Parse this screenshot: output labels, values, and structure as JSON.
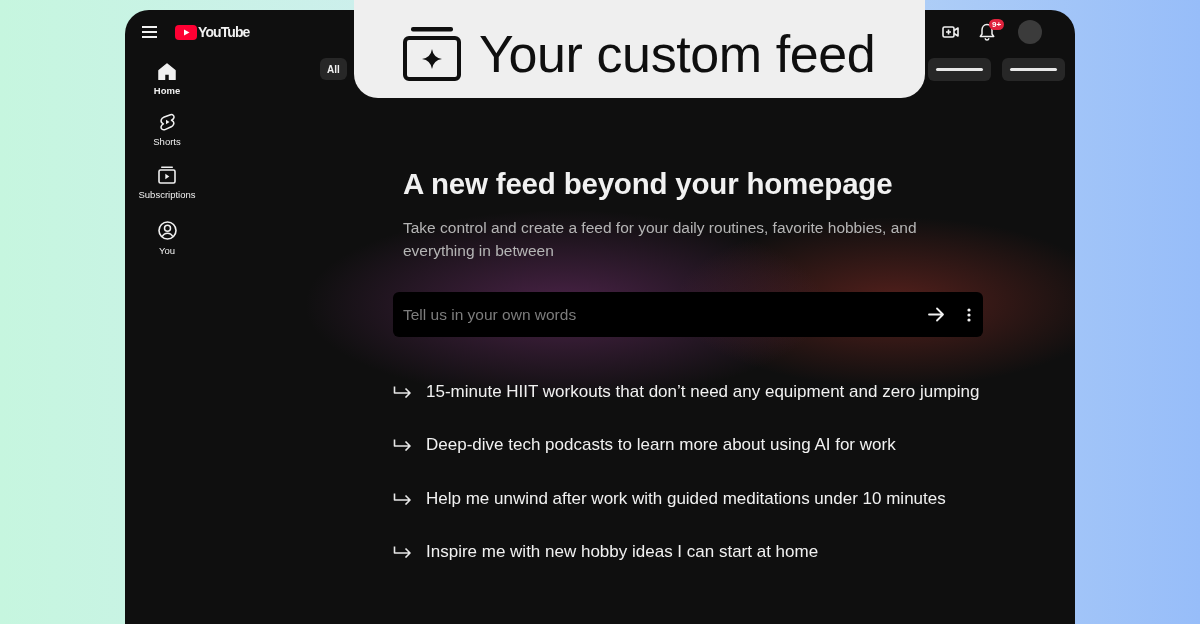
{
  "header": {
    "logo": "YouTube",
    "notification_count": "9+"
  },
  "sidebar": {
    "items": [
      {
        "label": "Home",
        "selected": true
      },
      {
        "label": "Shorts",
        "selected": false
      },
      {
        "label": "Subscriptions",
        "selected": false
      },
      {
        "label": "You",
        "selected": false
      }
    ]
  },
  "chips": [
    {
      "kind": "text",
      "label": "All"
    },
    {
      "kind": "placeholder"
    },
    {
      "kind": "placeholder"
    }
  ],
  "banner": {
    "title": "Your custom feed"
  },
  "feed_setup": {
    "heading": "A new feed beyond your homepage",
    "description": "Take control and create a feed for your daily routines, favorite hobbies, and everything in between",
    "prompt_field": {
      "placeholder": "Tell us in your own words"
    },
    "suggestions": [
      "15-minute HIIT workouts that don’t need any equipment and zero jumping",
      "Deep-dive tech podcasts to learn more about using AI for work",
      "Help me unwind after work with guided meditations under 10 minutes",
      "Inspire me with new hobby ideas I can start at home"
    ]
  }
}
